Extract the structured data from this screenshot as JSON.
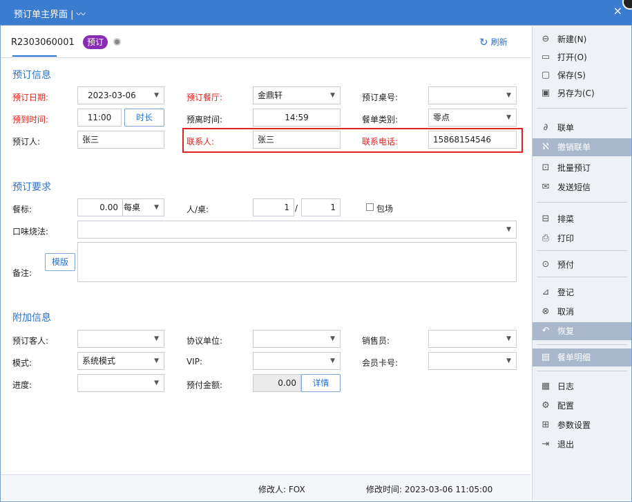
{
  "window": {
    "title": "预订单主界面 | ",
    "title_glyph": "〰",
    "close": "×"
  },
  "header": {
    "res_no": "R2303060001",
    "badge": "预订",
    "refresh": "刷新"
  },
  "sections": {
    "info": "预订信息",
    "req": "预订要求",
    "extra": "附加信息"
  },
  "info": {
    "date_label": "预订日期:",
    "date_value": "2023-03-06",
    "hall_label": "预订餐厅:",
    "hall_value": "金鼎轩",
    "table_label": "预订桌号:",
    "table_value": "",
    "arrive_label": "预到时间:",
    "arrive_value": "11:00",
    "duration_btn": "时长",
    "leave_label": "预离时间:",
    "leave_value": "14:59",
    "meal_type_label": "餐单类别:",
    "meal_type_value": "零点",
    "booker_label": "预订人:",
    "booker_value": "张三",
    "contact_label": "联系人:",
    "contact_value": "张三",
    "phone_label": "联系电话:",
    "phone_value": "15868154546"
  },
  "req": {
    "std_label": "餐标:",
    "std_value": "0.00",
    "std_unit": "每桌",
    "ppl_label": "人/桌:",
    "ppl_value1": "1",
    "ppl_sep": "/",
    "ppl_value2": "1",
    "private_label": "包场",
    "taste_label": "口味烧法:",
    "taste_value": "",
    "note_label": "备注:",
    "template_btn": "模版"
  },
  "extra": {
    "guest_label": "预订客人:",
    "unit_label": "协议单位:",
    "sales_label": "销售员:",
    "mode_label": "模式:",
    "mode_value": "系统模式",
    "vip_label": "VIP:",
    "card_label": "会员卡号:",
    "progress_label": "进度:",
    "prepay_label": "预付金额:",
    "prepay_value": "0.00",
    "detail_btn": "详情"
  },
  "status": {
    "modifier": "修改人: FOX",
    "mtime": "修改时间: 2023-03-06 11:05:00"
  },
  "sidebar": [
    {
      "label": "新建(N)",
      "icon": "⊖"
    },
    {
      "label": "打开(O)",
      "icon": "▭"
    },
    {
      "label": "保存(S)",
      "icon": "▢"
    },
    {
      "label": "另存为(C)",
      "icon": "▣"
    },
    {
      "label": "联单",
      "icon": "∂"
    },
    {
      "label": "撤销联单",
      "icon": "ℵ"
    },
    {
      "label": "批量预订",
      "icon": "⊡"
    },
    {
      "label": "发送短信",
      "icon": "✉"
    },
    {
      "label": "排菜",
      "icon": "⊟"
    },
    {
      "label": "打印",
      "icon": "⎙"
    },
    {
      "label": "预付",
      "icon": "⊙"
    },
    {
      "label": "登记",
      "icon": "⊿"
    },
    {
      "label": "取消",
      "icon": "⊗"
    },
    {
      "label": "恢复",
      "icon": "↶"
    },
    {
      "label": "餐单明细",
      "icon": "▤"
    },
    {
      "label": "日志",
      "icon": "▦"
    },
    {
      "label": "配置",
      "icon": "⚙"
    },
    {
      "label": "参数设置",
      "icon": "⊞"
    },
    {
      "label": "退出",
      "icon": "⇥"
    }
  ]
}
